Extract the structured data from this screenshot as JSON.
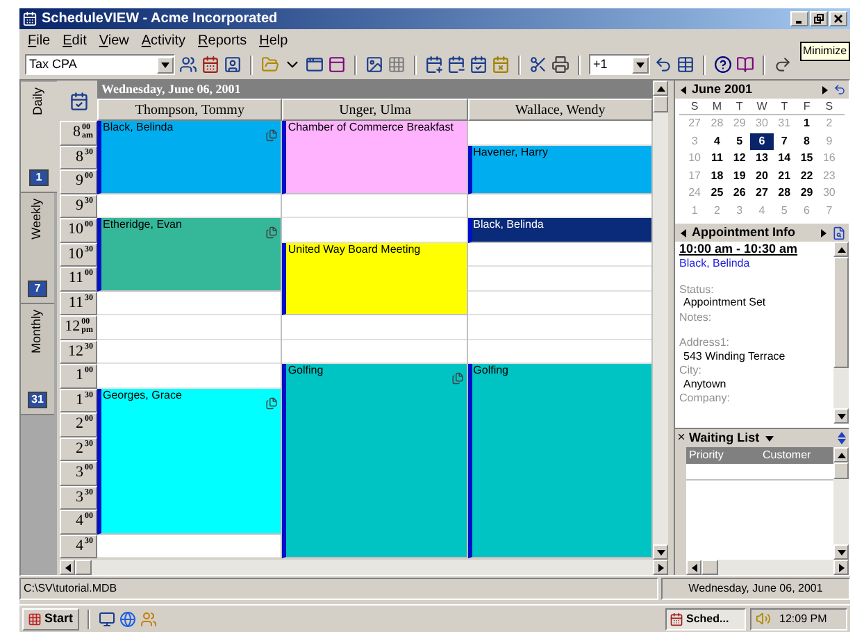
{
  "window": {
    "title": "ScheduleVIEW - Acme Incorporated"
  },
  "tooltip": "Minimize",
  "menu": [
    "File",
    "Edit",
    "View",
    "Activity",
    "Reports",
    "Help"
  ],
  "toolbar": {
    "resource_combo": "Tax CPA",
    "increment_field": "+1"
  },
  "view_tabs": [
    {
      "label": "Daily",
      "icon_text": "1",
      "selected": true
    },
    {
      "label": "Weekly",
      "icon_text": "7",
      "selected": false
    },
    {
      "label": "Monthly",
      "icon_text": "31",
      "selected": false
    }
  ],
  "schedule": {
    "date": "Wednesday, June 06, 2001",
    "times": [
      {
        "hour": "8",
        "minute": "00",
        "meridiem": "am"
      },
      {
        "hour": "8",
        "minute": "30"
      },
      {
        "hour": "9",
        "minute": "00"
      },
      {
        "hour": "9",
        "minute": "30"
      },
      {
        "hour": "10",
        "minute": "00"
      },
      {
        "hour": "10",
        "minute": "30"
      },
      {
        "hour": "11",
        "minute": "00"
      },
      {
        "hour": "11",
        "minute": "30"
      },
      {
        "hour": "12",
        "minute": "00",
        "meridiem": "pm"
      },
      {
        "hour": "12",
        "minute": "30"
      },
      {
        "hour": "1",
        "minute": "00"
      },
      {
        "hour": "1",
        "minute": "30"
      },
      {
        "hour": "2",
        "minute": "00"
      },
      {
        "hour": "2",
        "minute": "30"
      },
      {
        "hour": "3",
        "minute": "00"
      },
      {
        "hour": "3",
        "minute": "30"
      },
      {
        "hour": "4",
        "minute": "00"
      },
      {
        "hour": "4",
        "minute": "30"
      }
    ],
    "columns": [
      {
        "name": "Thompson, Tommy",
        "slots": [
          {
            "kind": "start",
            "title": "Black, Belinda",
            "color": "#00aeef",
            "note_icon": true
          },
          {
            "kind": "cont"
          },
          {
            "kind": "cont"
          },
          {
            "kind": "empty"
          },
          {
            "kind": "start",
            "title": "Etheridge, Evan",
            "color": "#35b899",
            "note_icon": true
          },
          {
            "kind": "cont"
          },
          {
            "kind": "cont"
          },
          {
            "kind": "empty"
          },
          {
            "kind": "empty"
          },
          {
            "kind": "empty"
          },
          {
            "kind": "empty"
          },
          {
            "kind": "start",
            "title": "Georges, Grace",
            "color": "#00ffff",
            "note_icon": true
          },
          {
            "kind": "cont"
          },
          {
            "kind": "cont"
          },
          {
            "kind": "cont"
          },
          {
            "kind": "cont"
          },
          {
            "kind": "cont"
          },
          {
            "kind": "empty"
          }
        ]
      },
      {
        "name": "Unger, Ulma",
        "slots": [
          {
            "kind": "start",
            "title": "Chamber of Commerce Breakfast",
            "color": "#ffb3ff",
            "note_icon": false
          },
          {
            "kind": "cont"
          },
          {
            "kind": "cont"
          },
          {
            "kind": "empty"
          },
          {
            "kind": "empty"
          },
          {
            "kind": "start",
            "title": "United Way Board Meeting",
            "color": "#ffff00",
            "note_icon": false
          },
          {
            "kind": "cont"
          },
          {
            "kind": "cont"
          },
          {
            "kind": "empty"
          },
          {
            "kind": "empty"
          },
          {
            "kind": "start",
            "title": "Golfing",
            "color": "#00c4c4",
            "note_icon": true
          },
          {
            "kind": "cont"
          },
          {
            "kind": "cont"
          },
          {
            "kind": "cont"
          },
          {
            "kind": "cont"
          },
          {
            "kind": "cont"
          },
          {
            "kind": "cont"
          },
          {
            "kind": "cont"
          }
        ]
      },
      {
        "name": "Wallace, Wendy",
        "slots": [
          {
            "kind": "empty"
          },
          {
            "kind": "start",
            "title": "Havener, Harry",
            "color": "#00aeef",
            "note_icon": false
          },
          {
            "kind": "cont"
          },
          {
            "kind": "empty"
          },
          {
            "kind": "start",
            "title": "Black, Belinda",
            "color": "#0a2a7a",
            "note_icon": false
          },
          {
            "kind": "empty"
          },
          {
            "kind": "empty"
          },
          {
            "kind": "empty"
          },
          {
            "kind": "empty"
          },
          {
            "kind": "empty"
          },
          {
            "kind": "start",
            "title": "Golfing",
            "color": "#00c4c4",
            "note_icon": false
          },
          {
            "kind": "cont"
          },
          {
            "kind": "cont"
          },
          {
            "kind": "cont"
          },
          {
            "kind": "cont"
          },
          {
            "kind": "cont"
          },
          {
            "kind": "cont"
          },
          {
            "kind": "cont"
          }
        ]
      }
    ]
  },
  "calendar": {
    "title": "June 2001",
    "weekdays": [
      "S",
      "M",
      "T",
      "W",
      "T",
      "F",
      "S"
    ],
    "days": [
      {
        "label": "27",
        "muted": true,
        "selected": false
      },
      {
        "label": "28",
        "muted": true,
        "selected": false
      },
      {
        "label": "29",
        "muted": true,
        "selected": false
      },
      {
        "label": "30",
        "muted": true,
        "selected": false
      },
      {
        "label": "31",
        "muted": true,
        "selected": false
      },
      {
        "label": "1",
        "muted": false,
        "selected": false
      },
      {
        "label": "2",
        "muted": true,
        "selected": false
      },
      {
        "label": "3",
        "muted": true,
        "selected": false
      },
      {
        "label": "4",
        "muted": false,
        "selected": false
      },
      {
        "label": "5",
        "muted": false,
        "selected": false
      },
      {
        "label": "6",
        "muted": false,
        "selected": true
      },
      {
        "label": "7",
        "muted": false,
        "selected": false
      },
      {
        "label": "8",
        "muted": false,
        "selected": false
      },
      {
        "label": "9",
        "muted": true,
        "selected": false
      },
      {
        "label": "10",
        "muted": true,
        "selected": false
      },
      {
        "label": "11",
        "muted": false,
        "selected": false
      },
      {
        "label": "12",
        "muted": false,
        "selected": false
      },
      {
        "label": "13",
        "muted": false,
        "selected": false
      },
      {
        "label": "14",
        "muted": false,
        "selected": false
      },
      {
        "label": "15",
        "muted": false,
        "selected": false
      },
      {
        "label": "16",
        "muted": true,
        "selected": false
      },
      {
        "label": "17",
        "muted": true,
        "selected": false
      },
      {
        "label": "18",
        "muted": false,
        "selected": false
      },
      {
        "label": "19",
        "muted": false,
        "selected": false
      },
      {
        "label": "20",
        "muted": false,
        "selected": false
      },
      {
        "label": "21",
        "muted": false,
        "selected": false
      },
      {
        "label": "22",
        "muted": false,
        "selected": false
      },
      {
        "label": "23",
        "muted": true,
        "selected": false
      },
      {
        "label": "24",
        "muted": true,
        "selected": false
      },
      {
        "label": "25",
        "muted": false,
        "selected": false
      },
      {
        "label": "26",
        "muted": false,
        "selected": false
      },
      {
        "label": "27",
        "muted": false,
        "selected": false
      },
      {
        "label": "28",
        "muted": false,
        "selected": false
      },
      {
        "label": "29",
        "muted": false,
        "selected": false
      },
      {
        "label": "30",
        "muted": true,
        "selected": false
      },
      {
        "label": "1",
        "muted": true,
        "selected": false
      },
      {
        "label": "2",
        "muted": true,
        "selected": false
      },
      {
        "label": "3",
        "muted": true,
        "selected": false
      },
      {
        "label": "4",
        "muted": true,
        "selected": false
      },
      {
        "label": "5",
        "muted": true,
        "selected": false
      },
      {
        "label": "6",
        "muted": true,
        "selected": false
      },
      {
        "label": "7",
        "muted": true,
        "selected": false
      }
    ]
  },
  "appointment_info": {
    "title": "Appointment Info",
    "time": "10:00 am - 10:30 am",
    "customer": "Black, Belinda",
    "fields": [
      {
        "label": "Status:",
        "value": "Appointment Set"
      },
      {
        "label": "Notes:"
      },
      {
        "label": "Address1:",
        "value": "543 Winding Terrace"
      },
      {
        "label": "City:",
        "value": "Anytown"
      },
      {
        "label": "Company:"
      }
    ]
  },
  "waiting_list": {
    "title": "Waiting List",
    "columns": [
      "Priority",
      "Customer"
    ]
  },
  "status_bar": [
    "C:\\SV\\tutorial.MDB",
    "Wednesday, June 06, 2001"
  ],
  "taskbar": {
    "start": "Start",
    "tasks": [
      {
        "label": "Sched...",
        "selected": true
      }
    ],
    "clock": "12:09 PM"
  }
}
